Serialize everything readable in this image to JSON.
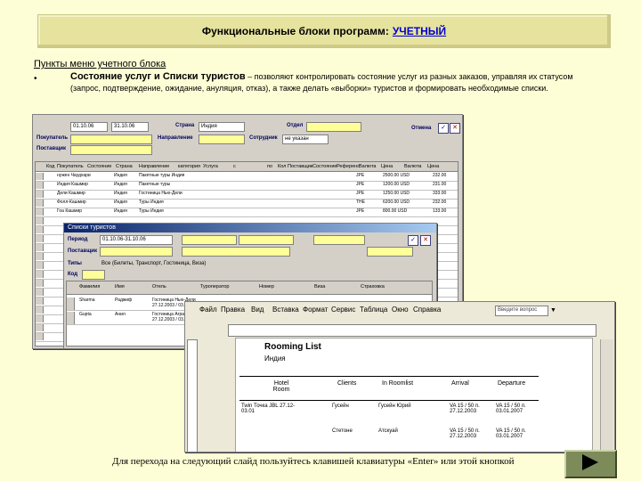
{
  "slide": {
    "title_prefix": "Функциональные блоки программ:",
    "title_link": "УЧЕТНЫЙ",
    "section_heading": "Пункты меню учетного блока",
    "bullet": "•",
    "body_bold": "Состояние услуг и Списки туристов",
    "body_text": " – позволяют контролировать состояние услуг из разных заказов, управляя их статусом (запрос, подтверждение, ожидание, ануляция, отказ), а также делать «выборки» туристов и формировать необходимые списки.",
    "footer": "Для перехода на следующий слайд пользуйтесь клавишей клавиатуры «Enter» или этой кнопкой"
  },
  "window1": {
    "labels": [
      "Отдел",
      "Покупатель",
      "Направление",
      "Поставщик",
      "Страна",
      "Сотрудник",
      "Отмена"
    ],
    "values": {
      "date_from": "01.10.06",
      "date_to": "31.10.06",
      "country": "Индия",
      "employee": "не указан"
    },
    "grid_headers": [
      "Код",
      "Покупатель",
      "Состояние",
      "Страна",
      "Направление",
      "категория",
      "Услуга",
      "с",
      "по",
      "Кол",
      "Поставщик",
      "Состояние",
      "Референс",
      "Валюта",
      "Цена",
      "Валюта",
      "Цена"
    ],
    "rows": [
      {
        "a": "нужен Чаудхари",
        "b": "Индия",
        "c": "Пакетные туры Индия",
        "d": "JPE",
        "e": "2500.00 USD",
        "f": "232.00"
      },
      {
        "a": "Индия Кашмир",
        "b": "Индия",
        "c": "Пакетные туры",
        "d": "JPE",
        "e": "1200.00 USD",
        "f": "231.00"
      },
      {
        "a": "Дели Кашмир",
        "b": "Индия",
        "c": "Гостиница Нью-Дели",
        "d": "JPE",
        "e": "1250.00 USD",
        "f": "333.00"
      },
      {
        "a": "Фолл-Кашмир",
        "b": "Индия",
        "c": "Туры Индия",
        "d": "THE",
        "e": "6200.00 USD",
        "f": "232.00"
      },
      {
        "a": "Гоа Кашмир",
        "b": "Индия",
        "c": "Туры Индия",
        "d": "JPE",
        "e": "800.00 USD",
        "f": "133.00"
      }
    ]
  },
  "window2": {
    "title": "Списки туристов",
    "labels": [
      "Период",
      "Поставщик",
      "Типы",
      "Код"
    ],
    "period_value": "01.10.06-31.10.06",
    "filter_text": "Все (Билеты, Транспорт, Гостиница, Виза)",
    "grid_headers": [
      "Фамилия",
      "Имя",
      "Отель",
      "Туроператор",
      "Номер",
      "Виза",
      "Страховка"
    ],
    "rows": [
      {
        "a": "Sharma",
        "b": "Раджиф",
        "c": "Гостиница Нью-Дели",
        "d": "27.12.2003 / 03.01.2007"
      },
      {
        "a": "Gupta",
        "b": "Анил",
        "c": "Гостиница Агра",
        "d": "27.12.2003 / 03.01.2007"
      }
    ]
  },
  "word": {
    "menus": [
      "Файл",
      "Правка",
      "Вид",
      "Вставка",
      "Формат",
      "Сервис",
      "Таблица",
      "Окно",
      "Справка"
    ],
    "help_box": "Введите вопрос",
    "doc_title": "Rooming List",
    "doc_subtitle": "Индия",
    "table_headers": [
      "Hotel Room",
      "Clients",
      "In Roomlist",
      "Arrival",
      "Departure"
    ],
    "table_rows": [
      {
        "hotel": "Twin Точка JBL 27.12-03.01",
        "client": "Гусейн",
        "inroom": "Гусейн Юрий",
        "arrival": "VA 15 / 50 п. 27.12.2003",
        "departure": "VA 15 / 50 п. 03.01.2007"
      },
      {
        "hotel": "",
        "client": "Стетоне",
        "inroom": "Атскуай",
        "arrival": "VA 15 / 50 п. 27.12.2003",
        "departure": "VA 15 / 50 п. 03.01.2007"
      }
    ]
  },
  "colors": {
    "slide_bg": "#fefed6",
    "title_bg": "#e6e39f",
    "link": "#0000cc",
    "field": "#ffff99",
    "button": "#7d8a5a"
  }
}
